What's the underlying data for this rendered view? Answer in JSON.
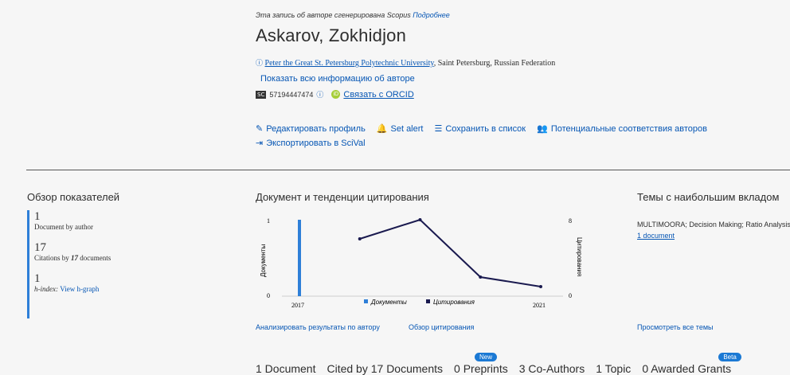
{
  "header": {
    "notice": "Эта запись об авторе сгенерирована Scopus",
    "notice_link": "Подробнее",
    "author_name": "Askarov, Zokhidjon",
    "affiliation_link": "Peter the Great St. Petersburg Polytechnic University",
    "affiliation_location": ", Saint Petersburg, Russian Federation",
    "show_all": "Показать всю информацию об авторе",
    "scopus_badge": "SC",
    "scopus_id": "57194447474",
    "orcid_link": "Связать с ORCID"
  },
  "actions": [
    {
      "icon": "✎",
      "label": "Редактировать профиль"
    },
    {
      "icon": "🔔",
      "label": "Set alert"
    },
    {
      "icon": "☰",
      "label": "Сохранить в список"
    },
    {
      "icon": "👥",
      "label": "Потенциальные соответствия авторов"
    }
  ],
  "export_action": {
    "icon": "⇥",
    "label": "Экспортировать в SciVal"
  },
  "metrics": {
    "title": "Обзор показателей",
    "documents_value": "1",
    "documents_label": "Document by author",
    "citations_value": "17",
    "citations_label_pre": "Citations by ",
    "citations_label_num": "17",
    "citations_label_post": " documents",
    "hindex_value": "1",
    "hindex_label": "h-index: ",
    "hindex_link": "View h-graph"
  },
  "trends": {
    "title": "Документ и тенденции цитирования",
    "links": [
      "Анализировать результаты по автору",
      "Обзор цитирования"
    ]
  },
  "chart_data": {
    "type": "bar",
    "categories": [
      "2017",
      "2018",
      "2019",
      "2020",
      "2021"
    ],
    "series": [
      {
        "name": "Документы",
        "type": "bar",
        "axis": "left",
        "values": [
          1,
          0,
          0,
          0,
          0
        ],
        "color": "#2e7fd8"
      },
      {
        "name": "Цитирования",
        "type": "line",
        "axis": "right",
        "values": [
          null,
          6,
          8,
          2,
          1
        ],
        "color": "#1a1a4f"
      }
    ],
    "xticks": [
      "2017",
      "2021"
    ],
    "ylabel_left": "Документы",
    "ylabel_right": "Цитирования",
    "ylim_left": [
      0,
      1
    ],
    "ylim_right": [
      0,
      8
    ],
    "left_ticks": [
      "1",
      "0"
    ],
    "right_ticks": [
      "8",
      "0"
    ],
    "legend_position": "bottom"
  },
  "topics": {
    "title": "Темы с наибольшим вкладом",
    "item": "MULTIMOORA; Decision Making; Ratio Analysis",
    "item_link": "1 document",
    "view_all": "Просмотреть все темы"
  },
  "tabs": [
    {
      "label": "1 Document",
      "badge": ""
    },
    {
      "label": "Cited by 17 Documents",
      "badge": ""
    },
    {
      "label": "0 Preprints",
      "badge": "New"
    },
    {
      "label": "3 Co-Authors",
      "badge": ""
    },
    {
      "label": "1 Topic",
      "badge": ""
    },
    {
      "label": "0 Awarded Grants",
      "badge": "Beta"
    }
  ]
}
